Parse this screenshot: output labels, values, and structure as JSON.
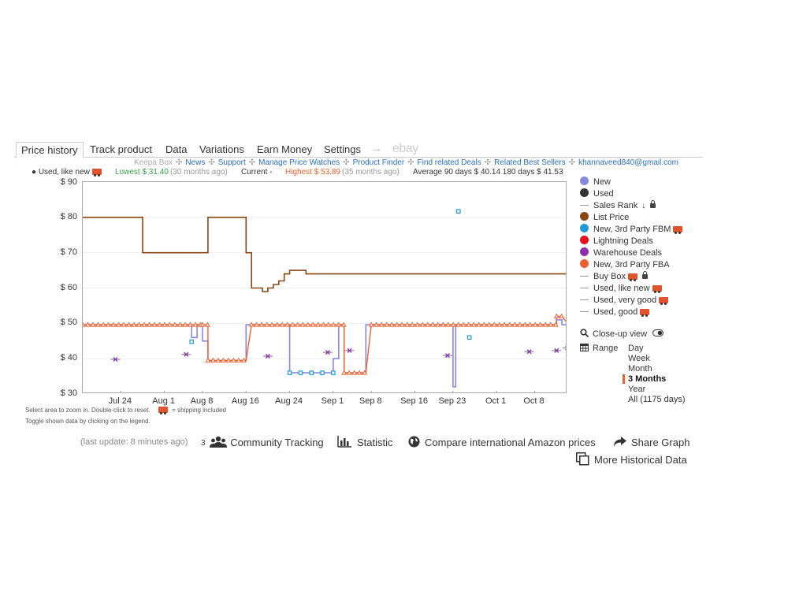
{
  "tabs": [
    {
      "label": "Price history",
      "active": true
    },
    {
      "label": "Track product",
      "active": false
    },
    {
      "label": "Data",
      "active": false
    },
    {
      "label": "Variations",
      "active": false
    },
    {
      "label": "Earn Money",
      "active": false
    },
    {
      "label": "Settings",
      "active": false
    }
  ],
  "tab_arrow": "→",
  "ebay_label": "ebay",
  "links": [
    "Keepa Box",
    "News",
    "Support",
    "Manage Price Watches",
    "Product Finder",
    "Find related Deals",
    "Related Best Sellers",
    "khannaveed840@gmail.com"
  ],
  "link_separator": "✣",
  "stats": {
    "selected": "● Used, like new",
    "lowest": "Lowest $ 31.40",
    "lowest_when": "(30 months ago)",
    "current": "Current -",
    "highest": "Highest $ 53.89",
    "highest_when": "(35 months ago)",
    "average": "Average 90 days $ 40.14  180 days $ 41.53"
  },
  "notes": [
    "Select area to zoom in. Double-click to reset.",
    "= shipping included",
    "Toggle shown data by clicking on the legend."
  ],
  "legend": [
    {
      "label": "New",
      "color": "#8888dd",
      "kind": "dot"
    },
    {
      "label": "Used",
      "color": "#333333",
      "kind": "dot"
    },
    {
      "label": "Sales Rank",
      "color": "#999999",
      "kind": "dash",
      "icon": "sort-numeric-icon",
      "lock": true
    },
    {
      "label": "List Price",
      "color": "#8b4513",
      "kind": "dot"
    },
    {
      "label": "New, 3rd Party FBM",
      "color": "#1e9bd7",
      "kind": "dot",
      "truck": true
    },
    {
      "label": "Lightning Deals",
      "color": "#e8101e",
      "kind": "dot"
    },
    {
      "label": "Warehouse Deals",
      "color": "#8f2fb0",
      "kind": "dot"
    },
    {
      "label": "New, 3rd Party FBA",
      "color": "#f0602e",
      "kind": "dot"
    },
    {
      "label": "Buy Box",
      "color": "#999999",
      "kind": "dash",
      "truck": true,
      "lock": true
    },
    {
      "label": "Used, like new",
      "color": "#999999",
      "kind": "dash",
      "truck": true
    },
    {
      "label": "Used, very good",
      "color": "#999999",
      "kind": "dash",
      "truck": true
    },
    {
      "label": "Used, good",
      "color": "#999999",
      "kind": "dash",
      "truck": true
    }
  ],
  "closeup_label": "Close-up view",
  "range_label": "Range",
  "ranges": [
    "Day",
    "Week",
    "Month",
    "3 Months",
    "Year",
    "All (1175 days)"
  ],
  "range_selected": "3 Months",
  "bottom": {
    "last_update": "(last update: 8 minutes ago)",
    "community_count": "3",
    "community": "Community Tracking",
    "statistic": "Statistic",
    "compare": "Compare international Amazon prices",
    "share": "Share Graph",
    "more": "More Historical Data"
  },
  "chart_data": {
    "type": "line",
    "ylim": [
      30,
      90
    ],
    "y_ticks": [
      "$ 90",
      "$ 80",
      "$ 70",
      "$ 60",
      "$ 50",
      "$ 40",
      "$ 30"
    ],
    "x_ticks": [
      "Jul 24",
      "Aug 1",
      "Aug 8",
      "Aug 16",
      "Aug 24",
      "Sep 1",
      "Sep 8",
      "Sep 16",
      "Sep 23",
      "Oct 1",
      "Oct 8"
    ],
    "x_tick_days": [
      7,
      15,
      22,
      30,
      38,
      46,
      53,
      61,
      68,
      76,
      83
    ],
    "x_range_days": [
      0,
      89
    ],
    "series": [
      {
        "name": "List Price",
        "color": "#8b4513",
        "points": [
          [
            0,
            80
          ],
          [
            11,
            80
          ],
          [
            11,
            70
          ],
          [
            23,
            70
          ],
          [
            23,
            80
          ],
          [
            30,
            80
          ],
          [
            30,
            70
          ],
          [
            31,
            70
          ],
          [
            31,
            60
          ],
          [
            33,
            60
          ],
          [
            33,
            59
          ],
          [
            34,
            59
          ],
          [
            34,
            60
          ],
          [
            35,
            60
          ],
          [
            35,
            61
          ],
          [
            36,
            61
          ],
          [
            36,
            62
          ],
          [
            37,
            62
          ],
          [
            37,
            64
          ],
          [
            38,
            64
          ],
          [
            38,
            65
          ],
          [
            41,
            65
          ],
          [
            41,
            64
          ],
          [
            89,
            64
          ]
        ]
      },
      {
        "name": "New, 3rd Party FBA",
        "color": "#f0602e",
        "points": [
          [
            0,
            49.6
          ],
          [
            22,
            49.6
          ],
          [
            23,
            49.6
          ],
          [
            23,
            39.5
          ],
          [
            30,
            39.5
          ],
          [
            31,
            49.6
          ],
          [
            48,
            49.6
          ],
          [
            48,
            36
          ],
          [
            52,
            36
          ],
          [
            53,
            49.6
          ],
          [
            87,
            49.6
          ],
          [
            87,
            52
          ],
          [
            88,
            52
          ],
          [
            89,
            50
          ]
        ]
      },
      {
        "name": "New",
        "color": "#8888dd",
        "points": [
          [
            0,
            49.6
          ],
          [
            20,
            49.6
          ],
          [
            20,
            46
          ],
          [
            21,
            46
          ],
          [
            21,
            49.6
          ],
          [
            22,
            49.6
          ],
          [
            22,
            45
          ],
          [
            23,
            45
          ],
          [
            23,
            39.5
          ],
          [
            30,
            39.5
          ],
          [
            30,
            49.6
          ],
          [
            38,
            49.6
          ],
          [
            38,
            36
          ],
          [
            46,
            36
          ],
          [
            46,
            40
          ],
          [
            47,
            40
          ],
          [
            47,
            49.6
          ],
          [
            48,
            49.6
          ],
          [
            48,
            36
          ],
          [
            52,
            36
          ],
          [
            52,
            49.6
          ],
          [
            68,
            49.6
          ],
          [
            68,
            32
          ],
          [
            68.5,
            32
          ],
          [
            68.5,
            49.6
          ],
          [
            87,
            49.6
          ],
          [
            87,
            51
          ],
          [
            88,
            51
          ],
          [
            88,
            49.6
          ],
          [
            89,
            49.6
          ]
        ]
      },
      {
        "name": "New, 3rd Party FBM",
        "color": "#1e9bd7",
        "points": [
          [
            20,
            44.8
          ],
          [
            38,
            36
          ],
          [
            40,
            36
          ],
          [
            42,
            36
          ],
          [
            44,
            36
          ],
          [
            46,
            36
          ],
          [
            69,
            81.7
          ],
          [
            71,
            46
          ]
        ]
      },
      {
        "name": "Warehouse Deals",
        "color": "#8f2fb0",
        "points": [
          [
            6,
            39.8
          ],
          [
            19,
            41.2
          ],
          [
            34,
            40.7
          ],
          [
            45,
            41.8
          ],
          [
            49,
            42.3
          ],
          [
            67,
            40.9
          ],
          [
            82,
            42
          ],
          [
            87,
            42.3
          ],
          [
            89,
            43
          ]
        ]
      }
    ]
  }
}
